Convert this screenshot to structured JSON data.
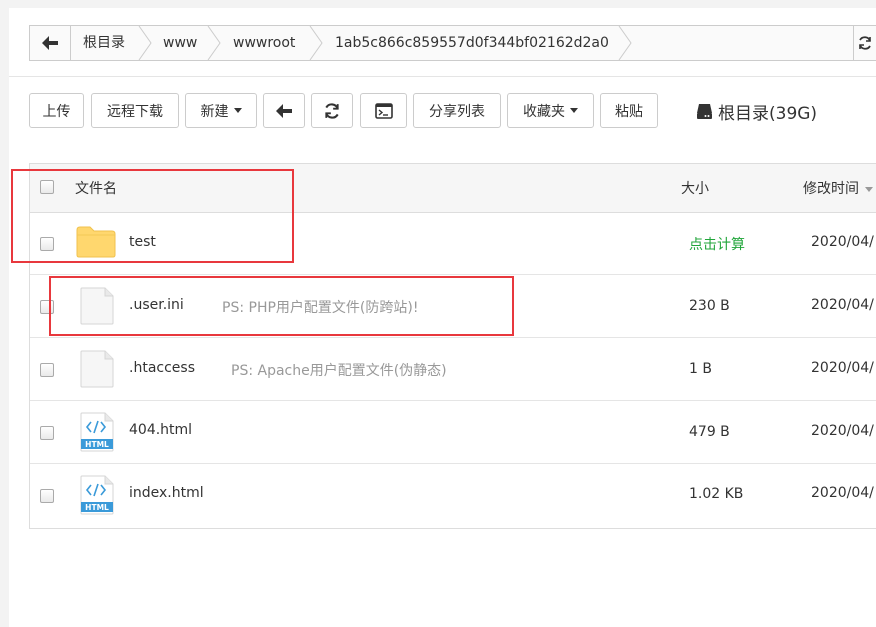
{
  "breadcrumb": {
    "items": [
      "根目录",
      "www",
      "wwwroot",
      "1ab5c866c859557d0f344bf02162d2a0"
    ]
  },
  "toolbar": {
    "upload": "上传",
    "remote_download": "远程下载",
    "new": "新建",
    "share_list": "分享列表",
    "favorites": "收藏夹",
    "paste": "粘贴",
    "disk_label": "根目录(39G)"
  },
  "table": {
    "columns": {
      "name": "文件名",
      "size": "大小",
      "mtime": "修改时间"
    },
    "rows": [
      {
        "name": "test",
        "type": "folder",
        "note": "",
        "size": "点击计算",
        "mtime": "2020/04/"
      },
      {
        "name": ".user.ini",
        "type": "file",
        "note": "PS: PHP用户配置文件(防跨站)!",
        "size": "230 B",
        "mtime": "2020/04/"
      },
      {
        "name": ".htaccess",
        "type": "file",
        "note": "PS: Apache用户配置文件(伪静态)",
        "size": "1 B",
        "mtime": "2020/04/"
      },
      {
        "name": "404.html",
        "type": "html",
        "note": "",
        "size": "479 B",
        "mtime": "2020/04/"
      },
      {
        "name": "index.html",
        "type": "html",
        "note": "",
        "size": "1.02 KB",
        "mtime": "2020/04/"
      }
    ]
  },
  "icons": {
    "html_badge": "HTML"
  },
  "colors": {
    "accent_green": "#20a53a",
    "highlight_red": "#e8383d",
    "folder_yellow": "#ffd76e"
  }
}
